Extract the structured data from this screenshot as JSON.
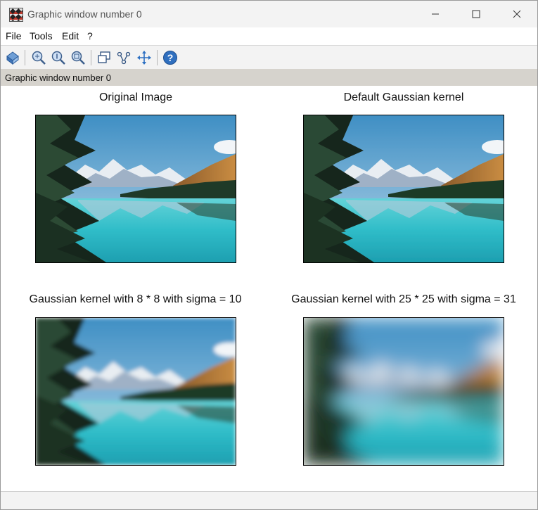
{
  "window": {
    "title": "Graphic window number 0"
  },
  "menu": {
    "file": "File",
    "tools": "Tools",
    "edit": "Edit",
    "help": "?"
  },
  "infobar": {
    "text": "Graphic window number 0"
  },
  "captions": {
    "original": "Original Image",
    "default_gaussian": "Default Gaussian kernel",
    "gaussian_8": "Gaussian kernel with 8 * 8 with sigma = 10",
    "gaussian_25": "Gaussian kernel with 25 * 25 with sigma = 31"
  },
  "blur_levels": {
    "original": 0,
    "default_gaussian": 0.3,
    "gaussian_8": 3,
    "gaussian_25": 12
  },
  "colors": {
    "sky_top": "#3f8fc4",
    "sky_bottom": "#b8d7ea",
    "lake": "#2fbcc8",
    "forest": "#1f3a28",
    "slope": "#b87c3a",
    "snow": "#e8edf2"
  }
}
